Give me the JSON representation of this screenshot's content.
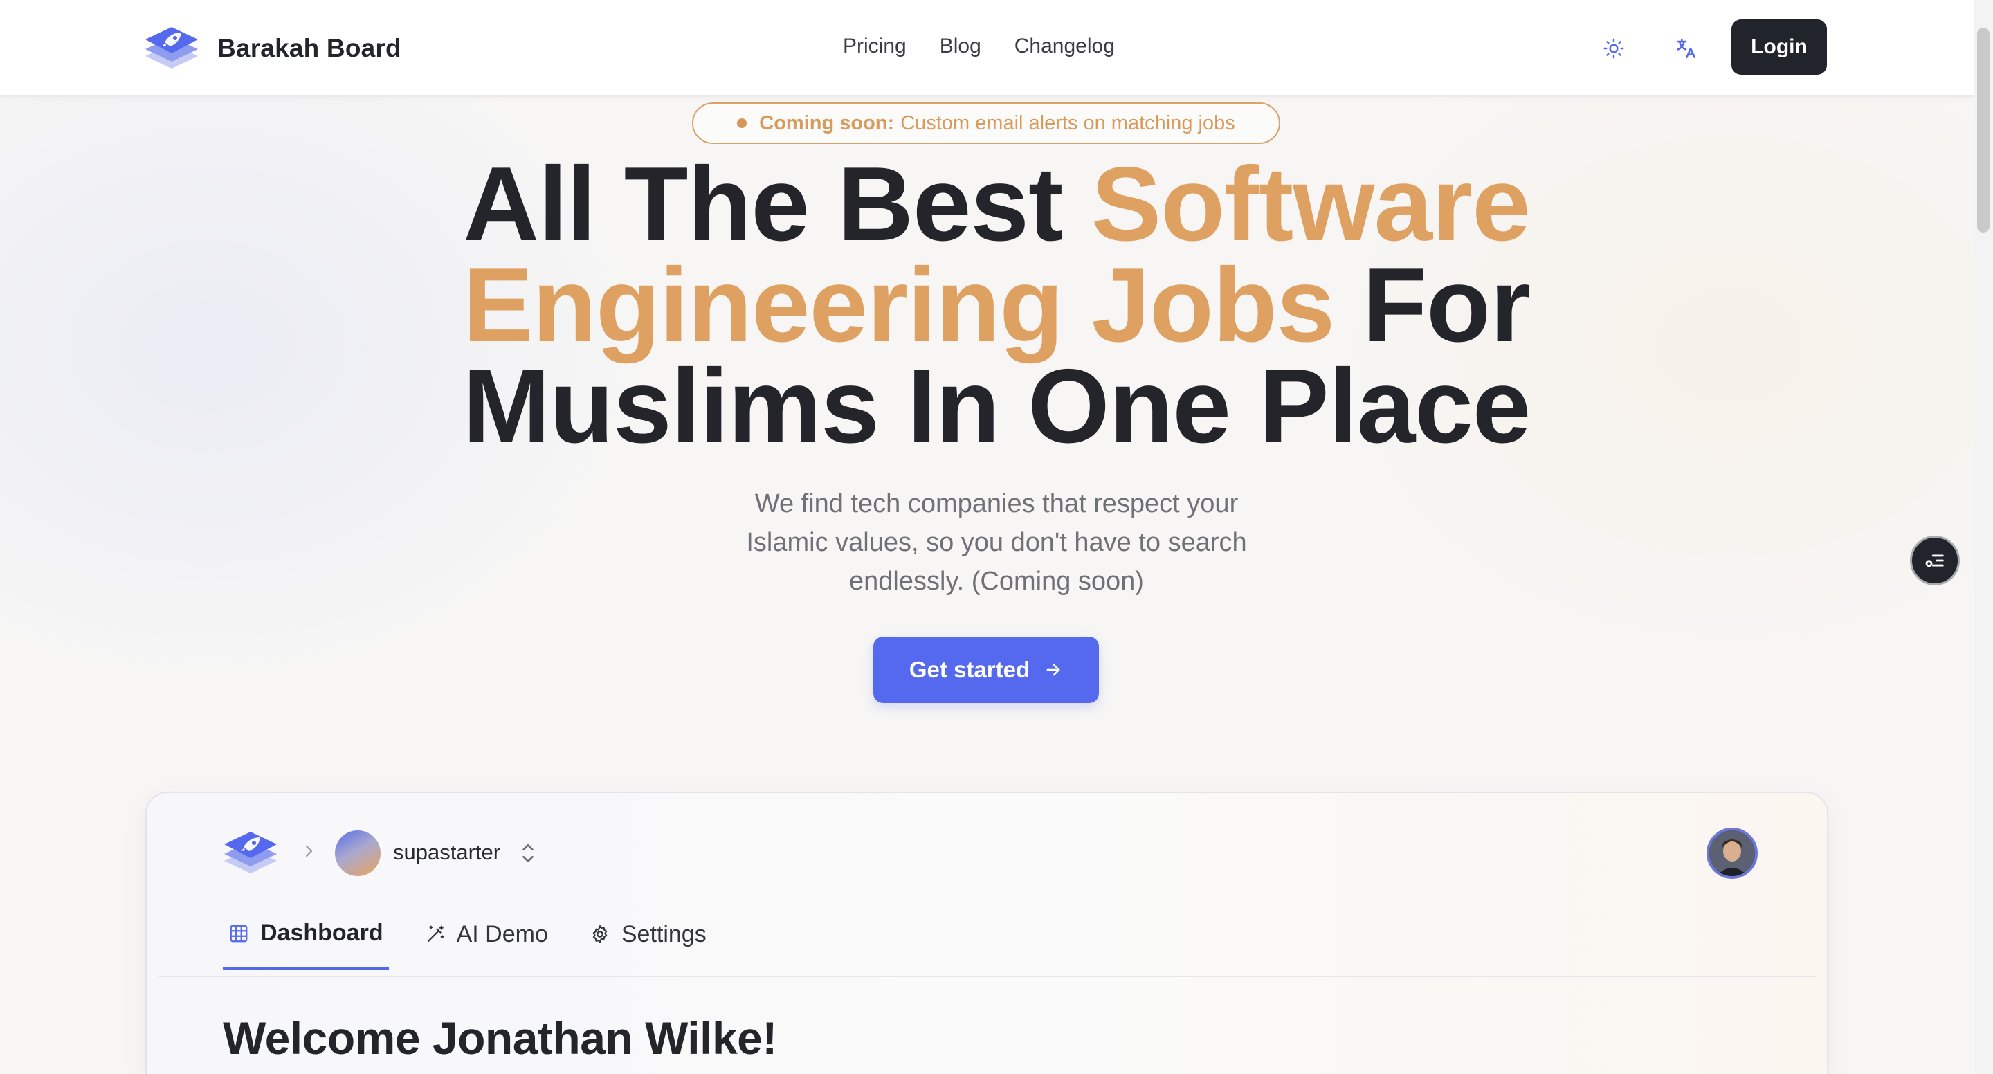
{
  "header": {
    "brand_name": "Barakah Board",
    "nav": [
      {
        "label": "Pricing"
      },
      {
        "label": "Blog"
      },
      {
        "label": "Changelog"
      }
    ],
    "theme_icon": "sun-icon",
    "language_icon": "translate-icon",
    "login_label": "Login"
  },
  "hero": {
    "announcement": {
      "strong": "Coming soon:",
      "text": "Custom email alerts on matching jobs"
    },
    "title": {
      "line1_plain": "All The Best ",
      "line1_accent": "Software",
      "line2_accent": "Engineering Jobs",
      "line2_plain": " For",
      "line3_plain": "Muslims In One Place"
    },
    "subtitle": "We find tech companies that respect your Islamic values, so you don't have to search endlessly. (Coming soon)",
    "cta_label": "Get started"
  },
  "preview": {
    "org_name": "supastarter",
    "tabs": [
      {
        "label": "Dashboard",
        "icon": "grid-icon",
        "active": true
      },
      {
        "label": "AI Demo",
        "icon": "magic-wand-icon",
        "active": false
      },
      {
        "label": "Settings",
        "icon": "gear-icon",
        "active": false
      }
    ],
    "welcome": "Welcome Jonathan Wilke!"
  },
  "colors": {
    "accent_orange": "#dea162",
    "primary_blue": "#5569ee",
    "dark": "#24252b"
  }
}
